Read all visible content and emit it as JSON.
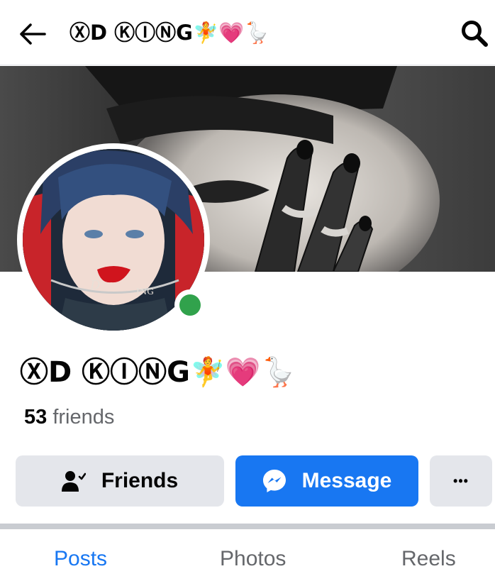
{
  "header": {
    "title": "ⓍD ⓀⒾⓃG🧚💗🪿",
    "back_icon": "arrow-left-icon",
    "search_icon": "search-icon"
  },
  "profile": {
    "name": "ⓍD ⓀⒾⓃG🧚💗🪿",
    "friends_count": "53",
    "friends_label": "friends",
    "online": true
  },
  "actions": {
    "friends_label": "Friends",
    "message_label": "Message",
    "more_label": "•••"
  },
  "tabs": [
    {
      "label": "Posts",
      "active": true
    },
    {
      "label": "Photos",
      "active": false
    },
    {
      "label": "Reels",
      "active": false
    }
  ],
  "colors": {
    "accent": "#1877f2",
    "online": "#31a24c",
    "secondary_button": "#e4e6eb"
  }
}
